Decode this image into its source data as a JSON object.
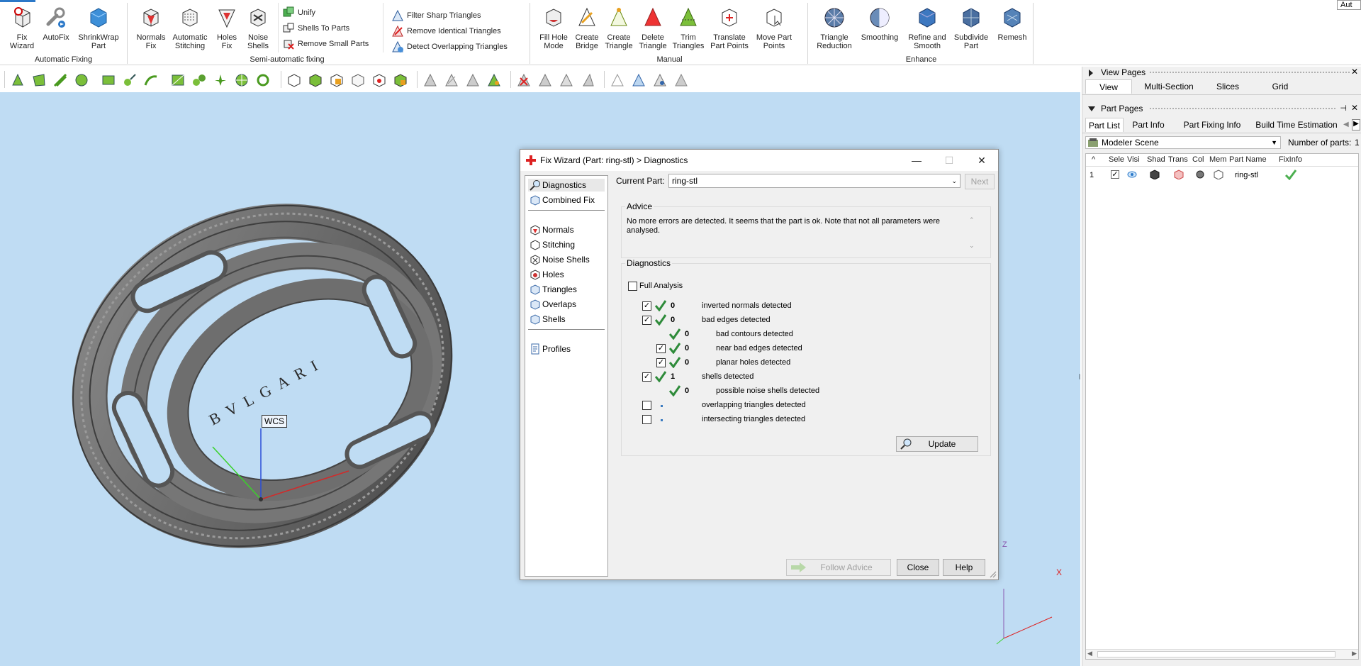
{
  "ribbon": {
    "groups": {
      "automatic": "Automatic Fixing",
      "semi": "Semi-automatic fixing",
      "manual": "Manual",
      "enhance": "Enhance"
    },
    "buttons": {
      "fix_wizard": "Fix\nWizard",
      "autofix": "AutoFix",
      "shrinkwrap": "ShrinkWrap\nPart",
      "normals_fix": "Normals\nFix",
      "auto_stitch": "Automatic\nStitching",
      "holes_fix": "Holes\nFix",
      "noise_shells": "Noise\nShells",
      "unify": "Unify",
      "shells_to_parts": "Shells To Parts",
      "remove_small_parts": "Remove Small Parts",
      "filter_sharp": "Filter Sharp Triangles",
      "remove_identical": "Remove Identical Triangles",
      "detect_overlapping": "Detect Overlapping Triangles",
      "fill_hole_mode": "Fill Hole\nMode",
      "create_bridge": "Create\nBridge",
      "create_triangle": "Create\nTriangle",
      "delete_triangle": "Delete\nTriangle",
      "trim_triangles": "Trim\nTriangles",
      "translate_points": "Translate\nPart Points",
      "move_points": "Move Part\nPoints",
      "triangle_reduction": "Triangle\nReduction",
      "smoothing": "Smoothing",
      "refine_smooth": "Refine and\nSmooth",
      "subdivide": "Subdivide\nPart",
      "remesh": "Remesh"
    },
    "aut": "Aut"
  },
  "viewport": {
    "wcs_label": "WCS",
    "engraving": "BVLGARI",
    "axis_z": "Z",
    "axis_x": "X"
  },
  "right_panel": {
    "view_pages": "View Pages",
    "view_tabs": [
      "View",
      "Multi-Section",
      "Slices",
      "Grid"
    ],
    "part_pages": "Part Pages",
    "part_tabs": [
      "Part List",
      "Part Info",
      "Part Fixing Info",
      "Build Time Estimation"
    ],
    "scene_select": "Modeler Scene",
    "num_parts_label": "Number of parts:",
    "num_parts": "1",
    "columns": [
      "^",
      "Sele",
      "Visi",
      "Shad",
      "Trans",
      "Col",
      "Mem",
      "Part Name",
      "FixInfo"
    ],
    "row": {
      "index": "1",
      "name": "ring-stl"
    }
  },
  "dialog": {
    "title": "Fix Wizard (Part: ring-stl) > Diagnostics",
    "nav": {
      "diagnostics": "Diagnostics",
      "combined_fix": "Combined Fix",
      "normals": "Normals",
      "stitching": "Stitching",
      "noise_shells": "Noise Shells",
      "holes": "Holes",
      "triangles": "Triangles",
      "overlaps": "Overlaps",
      "shells": "Shells",
      "profiles": "Profiles"
    },
    "current_part_label": "Current Part:",
    "current_part": "ring-stl",
    "next": "Next",
    "advice_label": "Advice",
    "advice_text": "No more errors are detected. It seems that the part is ok. Note that not all parameters were analysed.",
    "diagnostics_label": "Diagnostics",
    "full_analysis": "Full Analysis",
    "rows": [
      {
        "count": "0",
        "text": "inverted normals detected"
      },
      {
        "count": "0",
        "text": "bad edges detected"
      },
      {
        "count": "0",
        "text": "bad contours detected"
      },
      {
        "count": "0",
        "text": "near bad edges detected"
      },
      {
        "count": "0",
        "text": "planar holes detected"
      },
      {
        "count": "1",
        "text": "shells detected"
      },
      {
        "count": "0",
        "text": "possible noise shells detected"
      },
      {
        "count": "",
        "text": "overlapping triangles detected"
      },
      {
        "count": "",
        "text": "intersecting triangles detected"
      }
    ],
    "update": "Update",
    "follow_advice": "Follow Advice",
    "close": "Close",
    "help": "Help"
  }
}
